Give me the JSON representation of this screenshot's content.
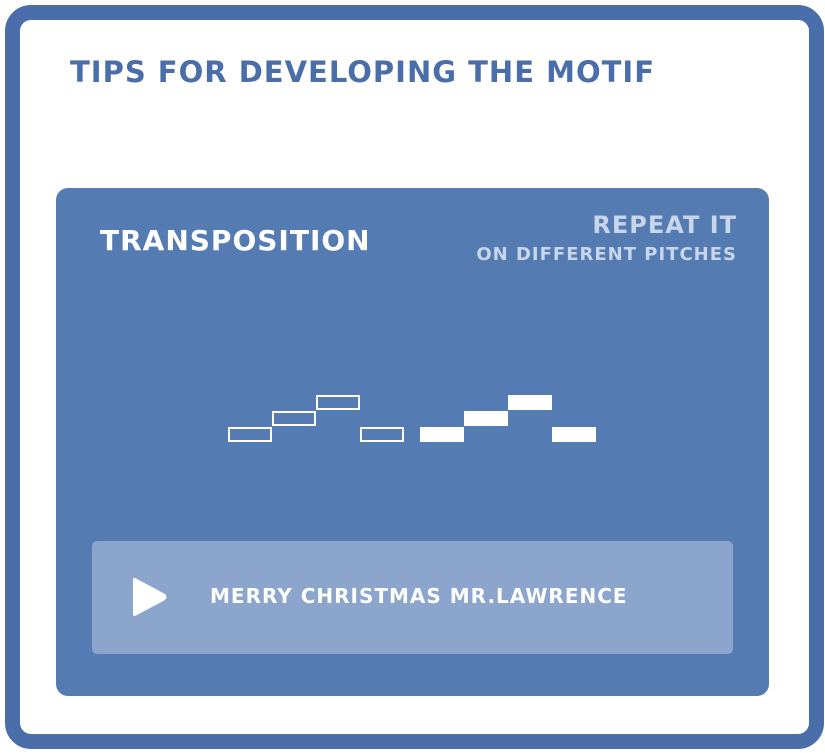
{
  "page": {
    "title": "Tips for developing the motif"
  },
  "card": {
    "title": "Transposition",
    "note_line1": "Repeat it",
    "note_line2": "on different pitches",
    "colors": {
      "background": "#547cb3",
      "note_text": "#c9d5ea",
      "frame": "#4a6ea9",
      "player_background": "#8ba5cc"
    }
  },
  "motif": {
    "original": {
      "style": "outline",
      "pitches": [
        0,
        1,
        2,
        0
      ]
    },
    "transposed": {
      "style": "filled",
      "pitches": [
        0,
        1,
        2,
        0
      ]
    }
  },
  "player": {
    "play_icon": "play-icon",
    "track_title": "Merry Christmas Mr.Lawrence"
  }
}
